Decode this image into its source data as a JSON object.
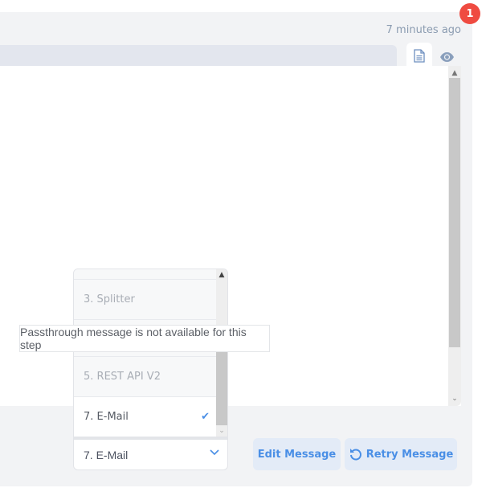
{
  "header": {
    "timestamp": "7 minutes ago",
    "notification_count": "1"
  },
  "tabs": [
    {
      "icon": "document-icon",
      "active": true
    },
    {
      "icon": "eye-icon",
      "active": false
    }
  ],
  "step_dropdown": {
    "items": [
      {
        "label": "",
        "disabled": true
      },
      {
        "label": "3. Splitter",
        "disabled": true
      },
      {
        "label": "",
        "disabled": true
      },
      {
        "label": "5. REST API V2",
        "disabled": true
      },
      {
        "label": "7. E-Mail",
        "disabled": false,
        "selected": true
      }
    ],
    "selected_value": "7. E-Mail"
  },
  "tooltip": {
    "text": "Passthrough message is not available for this step"
  },
  "actions": {
    "edit_label": "Edit Message",
    "retry_label": "Retry Message"
  },
  "colors": {
    "accent": "#4a8fe6",
    "badge": "#ef4b41",
    "button_bg": "#e3ebf7",
    "panel_bg": "#f2f3f5"
  }
}
